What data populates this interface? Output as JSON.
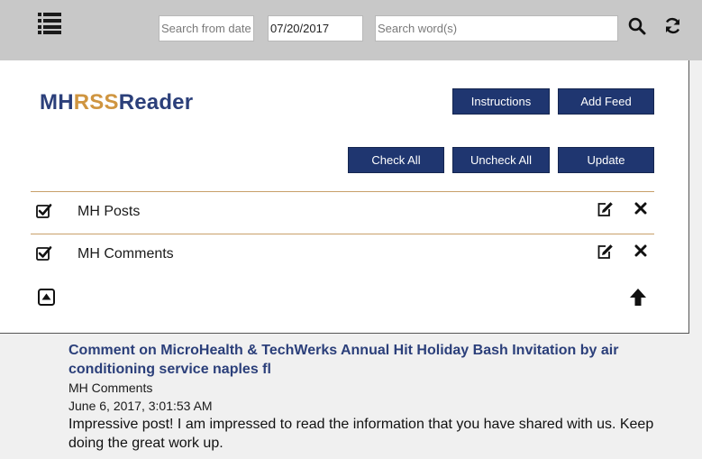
{
  "toolbar": {
    "search_from_date_placeholder": "Search from date",
    "date_value": "07/20/2017",
    "search_words_placeholder": "Search word(s)",
    "menu_icon": "hamburger-list-icon",
    "search_icon": "search-icon",
    "refresh_icon": "refresh-icon"
  },
  "logo": {
    "part1": "MH",
    "part2": "RSS",
    "part3": "Reader"
  },
  "buttons": {
    "instructions": "Instructions",
    "add_feed": "Add Feed",
    "check_all": "Check All",
    "uncheck_all": "Uncheck All",
    "update": "Update"
  },
  "feeds": [
    {
      "label": "MH Posts",
      "checked": true
    },
    {
      "label": "MH Comments",
      "checked": true
    }
  ],
  "post": {
    "title": "Comment on MicroHealth & TechWerks Annual Hit Holiday Bash Invitation by air conditioning service naples fl",
    "feed": "MH Comments",
    "date": "June 6, 2017, 3:01:53 AM",
    "body": "Impressive post! I am impressed to read the information that you have shared with us. Keep doing the great work up."
  },
  "colors": {
    "navy": "#1f3670",
    "logo_blue": "#2b3f7a",
    "logo_gold": "#cf9540",
    "divider": "#c8a06a"
  }
}
